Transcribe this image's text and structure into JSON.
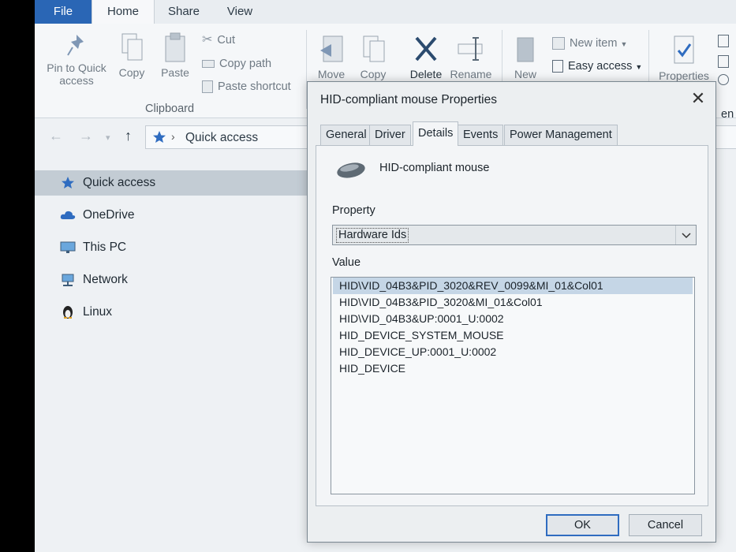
{
  "ribbon": {
    "tabs": {
      "file": "File",
      "home": "Home",
      "share": "Share",
      "view": "View"
    },
    "clipboard": {
      "pin_label_1": "Pin to Quick",
      "pin_label_2": "access",
      "copy": "Copy",
      "paste": "Paste",
      "cut": "Cut",
      "copy_path": "Copy path",
      "paste_shortcut": "Paste shortcut",
      "group_label": "Clipboard"
    },
    "organize": {
      "move": "Move",
      "copy": "Copy",
      "delete": "Delete",
      "rename": "Rename"
    },
    "new_group": {
      "new": "New",
      "new_item": "New item",
      "easy_access": "Easy access"
    },
    "open_group": {
      "properties": "Properties",
      "clipped": "en"
    }
  },
  "address_bar": {
    "path": "Quick access"
  },
  "nav_pane": {
    "items": [
      {
        "label": "Quick access",
        "icon": "star-icon"
      },
      {
        "label": "OneDrive",
        "icon": "cloud-icon"
      },
      {
        "label": "This PC",
        "icon": "monitor-icon"
      },
      {
        "label": "Network",
        "icon": "network-icon"
      },
      {
        "label": "Linux",
        "icon": "penguin-icon"
      }
    ]
  },
  "dialog": {
    "title": "HID-compliant mouse Properties",
    "tabs": [
      "General",
      "Driver",
      "Details",
      "Events",
      "Power Management"
    ],
    "active_tab": "Details",
    "device_name": "HID-compliant mouse",
    "property_label": "Property",
    "property_value": "Hardware Ids",
    "value_label": "Value",
    "values": [
      "HID\\VID_04B3&PID_3020&REV_0099&MI_01&Col01",
      "HID\\VID_04B3&PID_3020&MI_01&Col01",
      "HID\\VID_04B3&UP:0001_U:0002",
      "HID_DEVICE_SYSTEM_MOUSE",
      "HID_DEVICE_UP:0001_U:0002",
      "HID_DEVICE"
    ],
    "selected_value_index": 0,
    "ok": "OK",
    "cancel": "Cancel"
  },
  "colors": {
    "file_tab": "#2a66b5",
    "selection": "#c5d6e6",
    "nav_selected": "#c3ccd4",
    "default_button_border": "#2f6cc0"
  }
}
